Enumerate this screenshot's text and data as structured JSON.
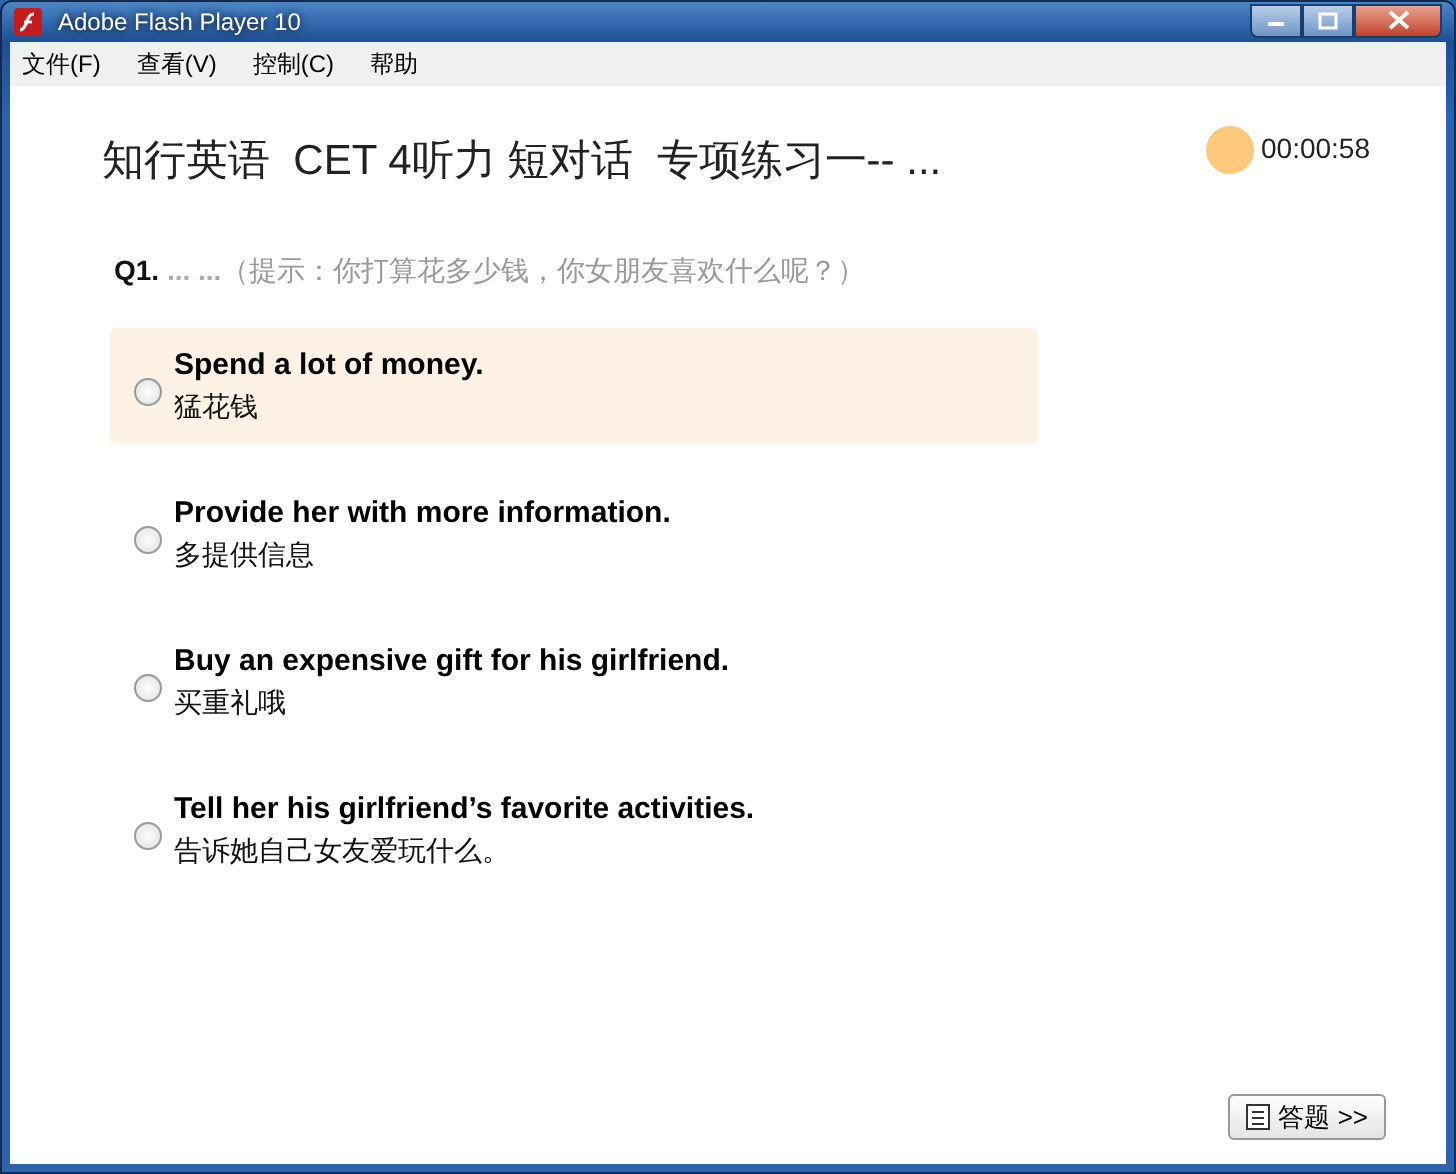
{
  "window": {
    "title": "Adobe Flash Player 10"
  },
  "menu": [
    {
      "label": "文件(F)"
    },
    {
      "label": "查看(V)"
    },
    {
      "label": "控制(C)"
    },
    {
      "label": "帮助"
    }
  ],
  "header": {
    "title": "知行英语  CET 4听力 短对话  专项练习一-- ...",
    "timer": "00:00:58"
  },
  "question": {
    "number": "Q1.",
    "blank": "... ...",
    "hint": "（提示：你打算花多少钱，你女朋友喜欢什么呢？）"
  },
  "options": [
    {
      "text": "Spend a lot of money.",
      "translation": "猛花钱",
      "selected": false,
      "highlighted": true
    },
    {
      "text": "Provide her with more information.",
      "translation": "多提供信息",
      "selected": false,
      "highlighted": false
    },
    {
      "text": "Buy an expensive gift for his girlfriend.",
      "translation": "买重礼哦",
      "selected": false,
      "highlighted": false
    },
    {
      "text": "Tell her his girlfriend’s favorite activities.",
      "translation": "告诉她自己女友爱玩什么。",
      "selected": false,
      "highlighted": false
    }
  ],
  "answer_button": {
    "label": "答题 >>"
  }
}
